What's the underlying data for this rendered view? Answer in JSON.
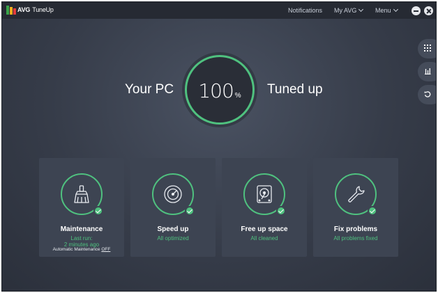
{
  "titlebar": {
    "brand_avg": "AVG",
    "brand_product": "TuneUp",
    "notifications": "Notifications",
    "my_avg": "My AVG",
    "menu": "Menu"
  },
  "hero": {
    "left": "Your PC",
    "value": "100",
    "unit": "%",
    "right": "Tuned up"
  },
  "cards": [
    {
      "title": "Maintenance",
      "status": "Last run:",
      "status2": "2 minutes ago",
      "note": "Automatic Maintenance",
      "note_toggle": "OFF",
      "icon": "broom-icon"
    },
    {
      "title": "Speed up",
      "status": "All optimized",
      "icon": "speedometer-icon"
    },
    {
      "title": "Free up space",
      "status": "All cleaned",
      "icon": "hard-drive-icon"
    },
    {
      "title": "Fix problems",
      "status": "All problems fixed",
      "icon": "wrench-icon"
    }
  ],
  "sidebar": [
    "apps-grid-icon",
    "stats-icon",
    "undo-icon"
  ],
  "colors": {
    "accent": "#4fc17f",
    "background": "#363c49",
    "card": "#3d4452"
  }
}
